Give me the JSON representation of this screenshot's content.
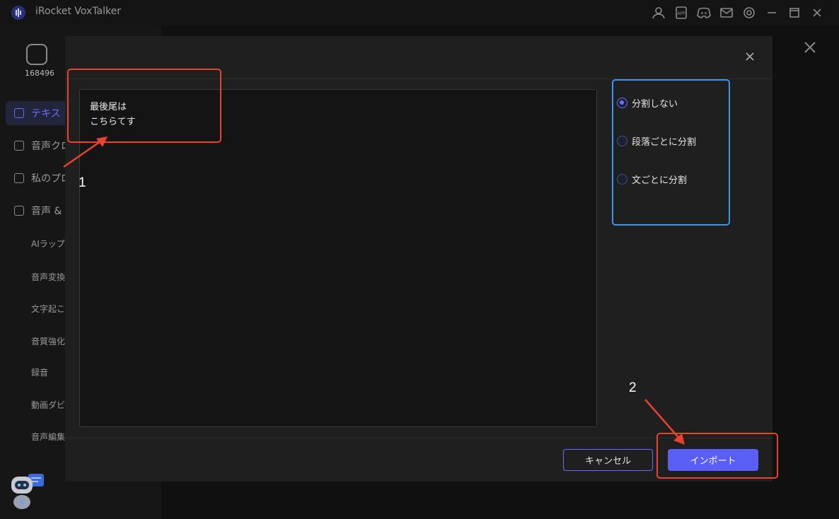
{
  "app": {
    "title": "iRocket VoxTalker",
    "titlebar_icons": [
      "user-icon",
      "app-icon",
      "discord-icon",
      "mail-icon",
      "settings-icon",
      "minimize-icon",
      "maximize-icon",
      "close-icon"
    ]
  },
  "sidebar": {
    "user_id": "168496",
    "items": [
      {
        "label": "テキス",
        "icon": "text-icon",
        "active": true
      },
      {
        "label": "音声クロ",
        "icon": "clone-icon",
        "active": false
      },
      {
        "label": "私のプロ",
        "icon": "folder-icon",
        "active": false
      },
      {
        "label": "音声 &",
        "icon": "toolbox-icon",
        "active": false
      }
    ],
    "subitems": [
      "AIラップ",
      "音声変換",
      "文字起こ",
      "音質強化",
      "録音",
      "動画ダビ",
      "音声編集"
    ]
  },
  "modal": {
    "text_lines": [
      "最後尾は",
      "こちらてす"
    ],
    "split_options": [
      {
        "label": "分割しない",
        "checked": true
      },
      {
        "label": "段落ごとに分割",
        "checked": false
      },
      {
        "label": "文ごとに分割",
        "checked": false
      }
    ],
    "cancel_label": "キャンセル",
    "import_label": "インポート"
  },
  "annotations": {
    "label_1": "1",
    "label_2": "2",
    "red_color": "#e8432f",
    "blue_color": "#3a96f0"
  },
  "colors": {
    "accent": "#5b5ef5",
    "background": "#101010",
    "modal_bg": "#1f1f1f"
  }
}
